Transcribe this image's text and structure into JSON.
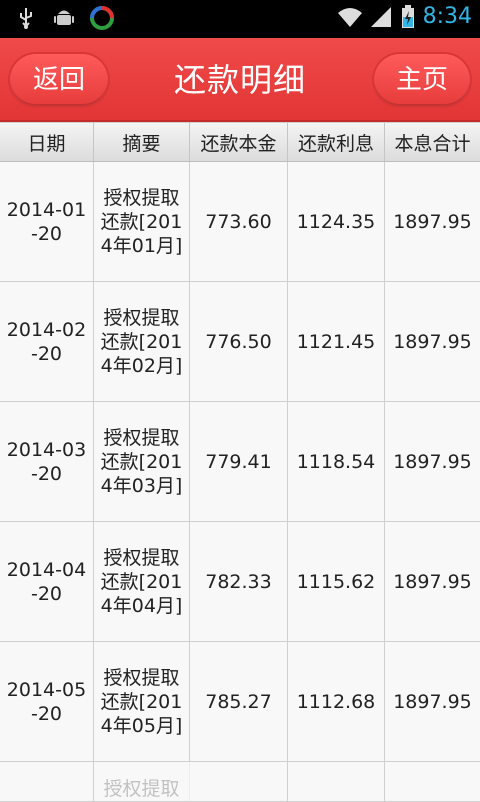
{
  "status_bar": {
    "time": "8:34",
    "icons": [
      "usb-icon",
      "android-debug-icon",
      "app-icon",
      "wifi-icon",
      "signal-icon",
      "battery-icon"
    ]
  },
  "header": {
    "back_label": "返回",
    "title": "还款明细",
    "home_label": "主页",
    "color": "#e23535"
  },
  "table": {
    "columns": [
      "日期",
      "摘要",
      "还款本金",
      "还款利息",
      "本息合计"
    ],
    "rows": [
      {
        "date": "2014-01-20",
        "summary": "授权提取还款[2014年01月]",
        "principal": "773.60",
        "interest": "1124.35",
        "total": "1897.95"
      },
      {
        "date": "2014-02-20",
        "summary": "授权提取还款[2014年02月]",
        "principal": "776.50",
        "interest": "1121.45",
        "total": "1897.95"
      },
      {
        "date": "2014-03-20",
        "summary": "授权提取还款[2014年03月]",
        "principal": "779.41",
        "interest": "1118.54",
        "total": "1897.95"
      },
      {
        "date": "2014-04-20",
        "summary": "授权提取还款[2014年04月]",
        "principal": "782.33",
        "interest": "1115.62",
        "total": "1897.95"
      },
      {
        "date": "2014-05-20",
        "summary": "授权提取还款[2014年05月]",
        "principal": "785.27",
        "interest": "1112.68",
        "total": "1897.95"
      },
      {
        "date": "",
        "summary": "授权提取",
        "principal": "",
        "interest": "",
        "total": ""
      }
    ]
  }
}
